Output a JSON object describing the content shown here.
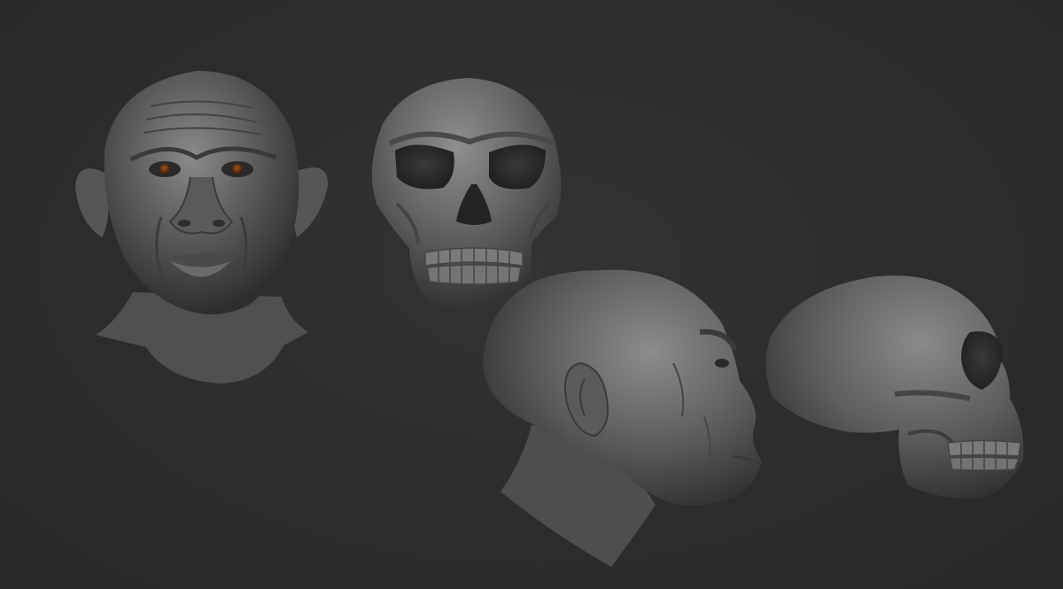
{
  "scene": {
    "background_color": "#2c2c2c",
    "material_color": "#6e6e6e",
    "eye_color": "#7a3a12",
    "models": [
      {
        "name": "hominin-head-front"
      },
      {
        "name": "hominin-skull-front"
      },
      {
        "name": "hominin-head-profile"
      },
      {
        "name": "hominin-skull-profile"
      }
    ]
  }
}
